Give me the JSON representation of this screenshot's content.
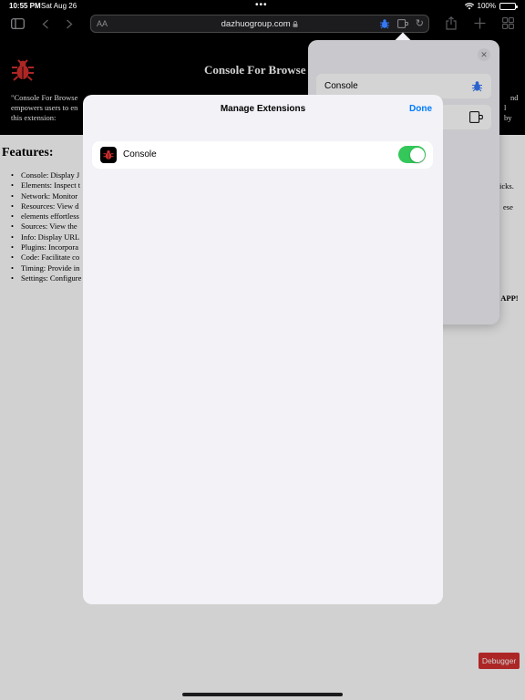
{
  "status_bar": {
    "time": "10:55 PM",
    "date": "Sat Aug 26",
    "battery": "100%"
  },
  "toolbar": {
    "domain": "dazhuogroup.com",
    "aa": "AA"
  },
  "page": {
    "title": "Console For Browse",
    "desc_line1": "\"Console For Browse",
    "desc_line1_right": "nd",
    "desc_line2": "empowers users to en",
    "desc_line2_right": "l by",
    "desc_line3": "this extension:",
    "features_heading": "Features:",
    "features": [
      "Console: Display J",
      "Elements: Inspect t",
      "Network: Monitor",
      "Resources: View d",
      "elements effortless",
      "Sources: View the",
      "Info: Display URL",
      "Plugins: Incorpora",
      "Code: Facilitate co",
      "Timing: Provide in",
      "Settings: Configure"
    ],
    "frag_clicks": "icks.",
    "frag_ese": "ese",
    "frag_app": "r APP!",
    "debugger_label": "Debugger"
  },
  "popover": {
    "items": [
      {
        "label": "Console"
      }
    ]
  },
  "sheet": {
    "title": "Manage Extensions",
    "done_label": "Done",
    "extensions": [
      {
        "name": "Console",
        "enabled": true
      }
    ]
  },
  "colors": {
    "accent": "#007aff",
    "toggle_on": "#34c759",
    "brand_red": "#d32f2f"
  }
}
